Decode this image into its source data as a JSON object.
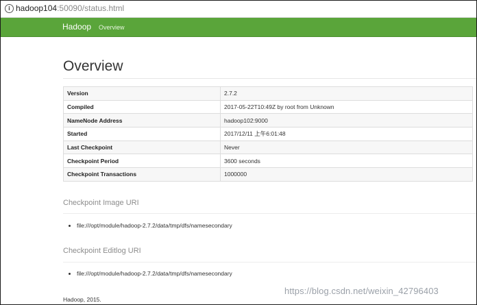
{
  "browser": {
    "url_host": "hadoop104",
    "url_rest": ":50090/status.html"
  },
  "navbar": {
    "brand": "Hadoop",
    "links": [
      {
        "label": "Overview"
      }
    ]
  },
  "page_title": "Overview",
  "info_table": [
    {
      "key": "Version",
      "value": "2.7.2"
    },
    {
      "key": "Compiled",
      "value": "2017-05-22T10:49Z by root from Unknown"
    },
    {
      "key": "NameNode Address",
      "value": "hadoop102:9000"
    },
    {
      "key": "Started",
      "value": "2017/12/11 上午6:01:48"
    },
    {
      "key": "Last Checkpoint",
      "value": "Never"
    },
    {
      "key": "Checkpoint Period",
      "value": "3600 seconds"
    },
    {
      "key": "Checkpoint Transactions",
      "value": "1000000"
    }
  ],
  "sections": [
    {
      "title": "Checkpoint Image URI",
      "items": [
        "file:///opt/module/hadoop-2.7.2/data/tmp/dfs/namesecondary"
      ]
    },
    {
      "title": "Checkpoint Editlog URI",
      "items": [
        "file:///opt/module/hadoop-2.7.2/data/tmp/dfs/namesecondary"
      ]
    }
  ],
  "footer": "Hadoop, 2015.",
  "watermark": "https://blog.csdn.net/weixin_42796403",
  "colors": {
    "navbar": "#5aa53a"
  }
}
